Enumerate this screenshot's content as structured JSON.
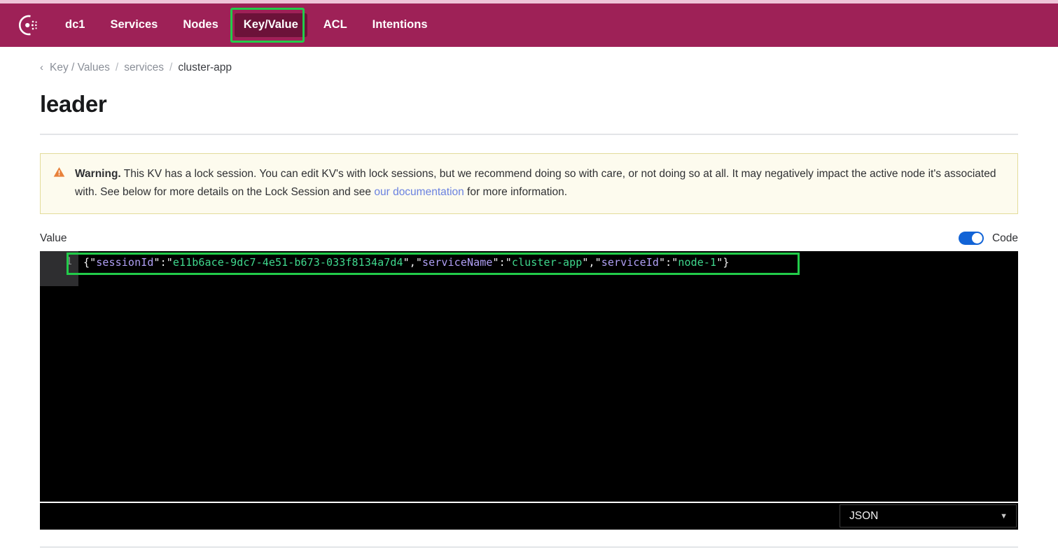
{
  "navbar": {
    "logo_name": "consul-logo",
    "brand_color": "#9e2157",
    "active_color": "#6c1239",
    "top_strip_color": "#efc4d8",
    "items": [
      {
        "label": "dc1",
        "active": false
      },
      {
        "label": "Services",
        "active": false
      },
      {
        "label": "Nodes",
        "active": false
      },
      {
        "label": "Key/Value",
        "active": true,
        "highlighted": true
      },
      {
        "label": "ACL",
        "active": false
      },
      {
        "label": "Intentions",
        "active": false
      }
    ]
  },
  "breadcrumb": {
    "back_icon": "chevron-left-icon",
    "back_glyph": "‹",
    "separator": "/",
    "items": [
      "Key / Values",
      "services",
      "cluster-app"
    ]
  },
  "page": {
    "title": "leader"
  },
  "warning": {
    "icon": "warning-triangle-icon",
    "label": "Warning.",
    "text_before": " This KV has a lock session. You can edit KV's with lock sessions, but we recommend doing so with care, or not doing so at all. It may negatively impact the active node it's associated with. See below for more details on the Lock Session and see ",
    "link_text": "our documentation",
    "text_after": " for more information.",
    "border_color": "#e3dc9a",
    "background_color": "#fdfbee",
    "icon_color": "#e8813a",
    "link_color": "#6b82e0"
  },
  "value_section": {
    "label": "Value",
    "code_toggle": {
      "label": "Code",
      "enabled": true,
      "on_color": "#1163d6"
    }
  },
  "editor": {
    "line_number": "1",
    "annotation_color": "#22cc4a",
    "background_color": "#000000",
    "gutter_color": "#2e2e30",
    "tokens": [
      {
        "t": "punc",
        "v": "{"
      },
      {
        "t": "punc",
        "v": "\""
      },
      {
        "t": "key",
        "v": "sessionId"
      },
      {
        "t": "punc",
        "v": "\""
      },
      {
        "t": "punc",
        "v": ":"
      },
      {
        "t": "punc",
        "v": "\""
      },
      {
        "t": "str",
        "v": "e11b6ace-9dc7-4e51-b673-033f8134a7d4"
      },
      {
        "t": "punc",
        "v": "\""
      },
      {
        "t": "punc",
        "v": ","
      },
      {
        "t": "punc",
        "v": "\""
      },
      {
        "t": "key",
        "v": "serviceName"
      },
      {
        "t": "punc",
        "v": "\""
      },
      {
        "t": "punc",
        "v": ":"
      },
      {
        "t": "punc",
        "v": "\""
      },
      {
        "t": "str",
        "v": "cluster-app"
      },
      {
        "t": "punc",
        "v": "\""
      },
      {
        "t": "punc",
        "v": ","
      },
      {
        "t": "punc",
        "v": "\""
      },
      {
        "t": "key",
        "v": "serviceId"
      },
      {
        "t": "punc",
        "v": "\""
      },
      {
        "t": "punc",
        "v": ":"
      },
      {
        "t": "punc",
        "v": "\""
      },
      {
        "t": "str",
        "v": "node-1"
      },
      {
        "t": "punc",
        "v": "\""
      },
      {
        "t": "punc",
        "v": "}"
      }
    ],
    "raw_value": "{\"sessionId\":\"e11b6ace-9dc7-4e51-b673-033f8134a7d4\",\"serviceName\":\"cluster-app\",\"serviceId\":\"node-1\"}",
    "format_select": {
      "selected": "JSON",
      "caret_icon": "chevron-down-icon",
      "caret_glyph": "▼"
    }
  }
}
